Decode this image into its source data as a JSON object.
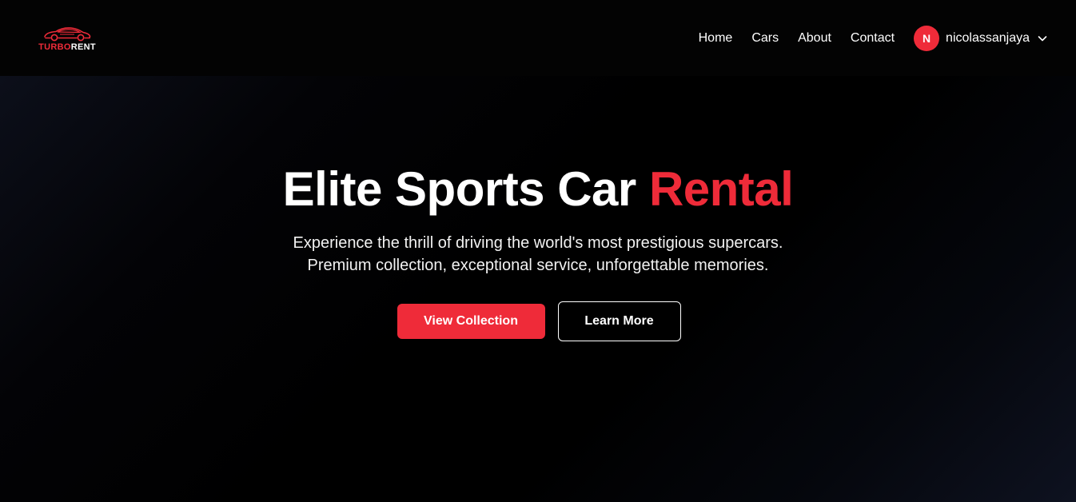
{
  "brand": {
    "logo_part1": "TURBO",
    "logo_part2": "RENT",
    "accent_color": "#ef2b39"
  },
  "nav": {
    "links": [
      {
        "label": "Home"
      },
      {
        "label": "Cars"
      },
      {
        "label": "About"
      },
      {
        "label": "Contact"
      }
    ],
    "user": {
      "initial": "N",
      "name": "nicolassanjaya",
      "menu_icon": "chevron-down-icon"
    }
  },
  "hero": {
    "title_main": "Elite Sports Car ",
    "title_accent": "Rental",
    "subtitle_line1": "Experience the thrill of driving the world's most prestigious supercars.",
    "subtitle_line2": "Premium collection, exceptional service, unforgettable memories.",
    "primary_button": "View Collection",
    "secondary_button": "Learn More"
  }
}
